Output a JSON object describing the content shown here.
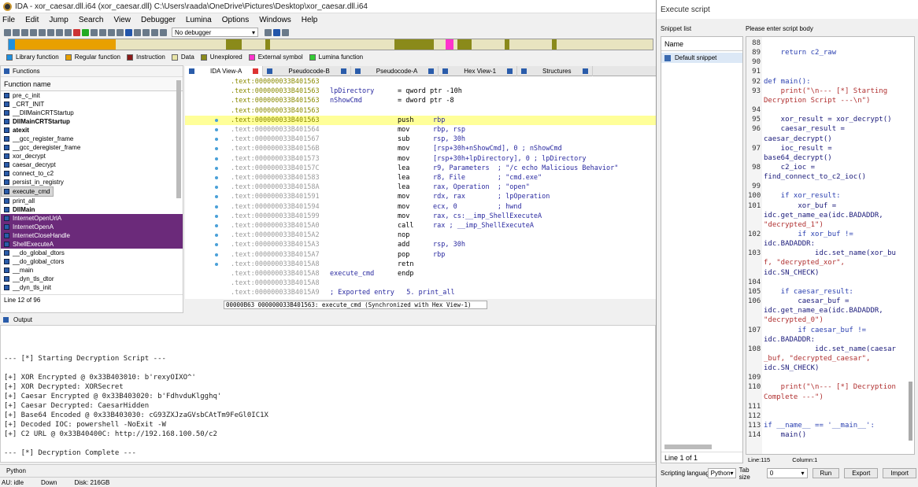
{
  "window": {
    "title": "IDA - xor_caesar.dll.i64 (xor_caesar.dll) C:\\Users\\raada\\OneDrive\\Pictures\\Desktop\\xor_caesar.dll.i64"
  },
  "menu": [
    "File",
    "Edit",
    "Jump",
    "Search",
    "View",
    "Debugger",
    "Lumina",
    "Options",
    "Windows",
    "Help"
  ],
  "toolbar": {
    "debugger": "No debugger"
  },
  "legend": [
    {
      "label": "Library function",
      "color": "#1e90e0"
    },
    {
      "label": "Regular function",
      "color": "#e8a000"
    },
    {
      "label": "Instruction",
      "color": "#8b1a1a"
    },
    {
      "label": "Data",
      "color": "#e8e4a8"
    },
    {
      "label": "Unexplored",
      "color": "#8a8a1a"
    },
    {
      "label": "External symbol",
      "color": "#ff33cc"
    },
    {
      "label": "Lumina function",
      "color": "#33cc33"
    }
  ],
  "functions": {
    "title": "Functions",
    "column": "Function name",
    "items": [
      {
        "name": "pre_c_init",
        "style": ""
      },
      {
        "name": "_CRT_INIT",
        "style": ""
      },
      {
        "name": "__DllMainCRTStartup",
        "style": ""
      },
      {
        "name": "DllMainCRTStartup",
        "style": "bold"
      },
      {
        "name": "atexit",
        "style": "bold"
      },
      {
        "name": "__gcc_register_frame",
        "style": ""
      },
      {
        "name": "__gcc_deregister_frame",
        "style": ""
      },
      {
        "name": "xor_decrypt",
        "style": ""
      },
      {
        "name": "caesar_decrypt",
        "style": ""
      },
      {
        "name": "connect_to_c2",
        "style": ""
      },
      {
        "name": "persist_in_registry",
        "style": ""
      },
      {
        "name": "execute_cmd",
        "style": "sel"
      },
      {
        "name": "print_all",
        "style": ""
      },
      {
        "name": "DllMain",
        "style": "bold"
      },
      {
        "name": "InternetOpenUrlA",
        "style": "lib"
      },
      {
        "name": "InternetOpenA",
        "style": "lib"
      },
      {
        "name": "InternetCloseHandle",
        "style": "lib"
      },
      {
        "name": "ShellExecuteA",
        "style": "lib"
      },
      {
        "name": "__do_global_dtors",
        "style": ""
      },
      {
        "name": "__do_global_ctors",
        "style": ""
      },
      {
        "name": "__main",
        "style": ""
      },
      {
        "name": "__dyn_tls_dtor",
        "style": ""
      },
      {
        "name": "__dyn_tls_init",
        "style": ""
      }
    ],
    "status": "Line 12 of 96"
  },
  "tabs": [
    {
      "label": "IDA View-A",
      "active": true
    },
    {
      "label": "Pseudocode-B",
      "active": false
    },
    {
      "label": "Pseudocode-A",
      "active": false
    },
    {
      "label": "Hex View-1",
      "active": false
    },
    {
      "label": "Structures",
      "active": false
    }
  ],
  "disasm": [
    {
      "addr": ".text:000000033B401563",
      "a": "",
      "b": "",
      "c": "",
      "dot": false,
      "grey": false
    },
    {
      "addr": ".text:000000033B401563",
      "a": "lpDirectory",
      "b": "= qword ptr -10h",
      "c": "",
      "dot": false,
      "grey": false
    },
    {
      "addr": ".text:000000033B401563",
      "a": "nShowCmd",
      "b": "= dword ptr -8",
      "c": "",
      "dot": false,
      "grey": false
    },
    {
      "addr": ".text:000000033B401563",
      "a": "",
      "b": "",
      "c": "",
      "dot": false,
      "grey": false
    },
    {
      "addr": ".text:000000033B401563",
      "a": "",
      "b": "push",
      "c": "rbp",
      "dot": true,
      "grey": false,
      "hl": true
    },
    {
      "addr": ".text:000000033B401564",
      "a": "",
      "b": "mov",
      "c": "rbp, rsp",
      "dot": true,
      "grey": true
    },
    {
      "addr": ".text:000000033B401567",
      "a": "",
      "b": "sub",
      "c": "rsp, 30h",
      "dot": true,
      "grey": true
    },
    {
      "addr": ".text:000000033B40156B",
      "a": "",
      "b": "mov",
      "c": "[rsp+30h+nShowCmd], 0 ; nShowCmd",
      "dot": true,
      "grey": true
    },
    {
      "addr": ".text:000000033B401573",
      "a": "",
      "b": "mov",
      "c": "[rsp+30h+lpDirectory], 0 ; lpDirectory",
      "dot": true,
      "grey": true
    },
    {
      "addr": ".text:000000033B40157C",
      "a": "",
      "b": "lea",
      "c": "r9, Parameters  ; \"/c echo Malicious Behavior\"",
      "dot": true,
      "grey": true
    },
    {
      "addr": ".text:000000033B401583",
      "a": "",
      "b": "lea",
      "c": "r8, File        ; \"cmd.exe\"",
      "dot": true,
      "grey": true
    },
    {
      "addr": ".text:000000033B40158A",
      "a": "",
      "b": "lea",
      "c": "rax, Operation  ; \"open\"",
      "dot": true,
      "grey": true
    },
    {
      "addr": ".text:000000033B401591",
      "a": "",
      "b": "mov",
      "c": "rdx, rax        ; lpOperation",
      "dot": true,
      "grey": true
    },
    {
      "addr": ".text:000000033B401594",
      "a": "",
      "b": "mov",
      "c": "ecx, 0          ; hwnd",
      "dot": true,
      "grey": true
    },
    {
      "addr": ".text:000000033B401599",
      "a": "",
      "b": "mov",
      "c": "rax, cs:__imp_ShellExecuteA",
      "dot": true,
      "grey": true
    },
    {
      "addr": ".text:000000033B4015A0",
      "a": "",
      "b": "call",
      "c": "rax ; __imp_ShellExecuteA",
      "dot": true,
      "grey": true
    },
    {
      "addr": ".text:000000033B4015A2",
      "a": "",
      "b": "nop",
      "c": "",
      "dot": true,
      "grey": true
    },
    {
      "addr": ".text:000000033B4015A3",
      "a": "",
      "b": "add",
      "c": "rsp, 30h",
      "dot": true,
      "grey": true
    },
    {
      "addr": ".text:000000033B4015A7",
      "a": "",
      "b": "pop",
      "c": "rbp",
      "dot": true,
      "grey": true
    },
    {
      "addr": ".text:000000033B4015A8",
      "a": "",
      "b": "retn",
      "c": "",
      "dot": true,
      "grey": true
    },
    {
      "addr": ".text:000000033B4015A8",
      "a": "execute_cmd",
      "b": "endp",
      "c": "",
      "dot": false,
      "grey": true
    },
    {
      "addr": ".text:000000033B4015A8",
      "a": "",
      "b": "",
      "c": "",
      "dot": false,
      "grey": true
    },
    {
      "addr": ".text:000000033B4015A9",
      "a": "; Exported entry   5. print_all",
      "b": "",
      "c": "",
      "dot": false,
      "grey": true
    }
  ],
  "disasm_status": "00000B63 000000033B401563: execute_cmd (Synchronized with Hex View-1)",
  "output": {
    "title": "Output",
    "lines": [
      "",
      "",
      "",
      "--- [*] Starting Decryption Script ---",
      "",
      "[+] XOR Encrypted @ 0x33B403010: b'rexyOIXO^'",
      "[+] XOR Decrypted: XORSecret",
      "[+] Caesar Encrypted @ 0x33B403020: b'FdhvduKlgghq'",
      "[+] Caesar Decrypted: CaesarHidden",
      "[+] Base64 Encoded @ 0x33B403030: cG93ZXJzaGVsbCAtTm9FeGl0IC1X",
      "[+] Decoded IOC: powershell -NoExit -W",
      "[+] C2 URL @ 0x33B40400C: http://192.168.100.50/c2",
      "",
      "--- [*] Decryption Complete ---"
    ],
    "lang": "Python"
  },
  "statusbar": {
    "au": "AU:  idle",
    "dir": "Down",
    "disk": "Disk: 216GB"
  },
  "dialog": {
    "title": "Execute script",
    "snippet_list_label": "Snippet list",
    "snippet_col": "Name",
    "snippet_item": "Default snippet",
    "snippet_footer": "Line 1 of 1",
    "body_label": "Please enter script body",
    "code": [
      {
        "n": "88",
        "t": "",
        "c": ""
      },
      {
        "n": "89",
        "t": "    return c2_raw",
        "c": "kw"
      },
      {
        "n": "90",
        "t": "",
        "c": ""
      },
      {
        "n": "91",
        "t": "",
        "c": ""
      },
      {
        "n": "92",
        "t": "def main():",
        "c": "kw"
      },
      {
        "n": "93",
        "t": "    print(\"\\n--- [*] Starting",
        "c": "str"
      },
      {
        "n": "",
        "t": "Decryption Script ---\\n\")",
        "c": "str"
      },
      {
        "n": "94",
        "t": "",
        "c": ""
      },
      {
        "n": "95",
        "t": "    xor_result = xor_decrypt()",
        "c": ""
      },
      {
        "n": "96",
        "t": "    caesar_result =",
        "c": ""
      },
      {
        "n": "",
        "t": "caesar_decrypt()",
        "c": ""
      },
      {
        "n": "97",
        "t": "    ioc_result =",
        "c": ""
      },
      {
        "n": "",
        "t": "base64_decrypt()",
        "c": ""
      },
      {
        "n": "98",
        "t": "    c2_ioc =",
        "c": ""
      },
      {
        "n": "",
        "t": "find_connect_to_c2_ioc()",
        "c": ""
      },
      {
        "n": "99",
        "t": "",
        "c": ""
      },
      {
        "n": "100",
        "t": "    if xor_result:",
        "c": "kw"
      },
      {
        "n": "101",
        "t": "        xor_buf =",
        "c": ""
      },
      {
        "n": "",
        "t": "idc.get_name_ea(idc.BADADDR,",
        "c": ""
      },
      {
        "n": "",
        "t": "\"decrypted_1\")",
        "c": "str"
      },
      {
        "n": "102",
        "t": "        if xor_buf !=",
        "c": "kw"
      },
      {
        "n": "",
        "t": "idc.BADADDR:",
        "c": ""
      },
      {
        "n": "103",
        "t": "            idc.set_name(xor_bu",
        "c": ""
      },
      {
        "n": "",
        "t": "f, \"decrypted_xor\",",
        "c": "str"
      },
      {
        "n": "",
        "t": "idc.SN_CHECK)",
        "c": ""
      },
      {
        "n": "104",
        "t": "",
        "c": ""
      },
      {
        "n": "105",
        "t": "    if caesar_result:",
        "c": "kw"
      },
      {
        "n": "106",
        "t": "        caesar_buf =",
        "c": ""
      },
      {
        "n": "",
        "t": "idc.get_name_ea(idc.BADADDR,",
        "c": ""
      },
      {
        "n": "",
        "t": "\"decrypted_0\")",
        "c": "str"
      },
      {
        "n": "107",
        "t": "        if caesar_buf !=",
        "c": "kw"
      },
      {
        "n": "",
        "t": "idc.BADADDR:",
        "c": ""
      },
      {
        "n": "108",
        "t": "            idc.set_name(caesar",
        "c": ""
      },
      {
        "n": "",
        "t": "_buf, \"decrypted_caesar\",",
        "c": "str"
      },
      {
        "n": "",
        "t": "idc.SN_CHECK)",
        "c": ""
      },
      {
        "n": "109",
        "t": "",
        "c": ""
      },
      {
        "n": "110",
        "t": "    print(\"\\n--- [*] Decryption",
        "c": "str"
      },
      {
        "n": "",
        "t": "Complete ---\")",
        "c": "str"
      },
      {
        "n": "111",
        "t": "",
        "c": ""
      },
      {
        "n": "112",
        "t": "",
        "c": ""
      },
      {
        "n": "113",
        "t": "if __name__ == '__main__':",
        "c": "kw"
      },
      {
        "n": "114",
        "t": "    main()",
        "c": ""
      }
    ],
    "code_line": "Line:115",
    "code_col": "Column:1",
    "lang_label": "Scripting language",
    "lang": "Python",
    "tab_label": "Tab size",
    "tab_size": "0",
    "run": "Run",
    "export": "Export",
    "import": "Import"
  }
}
